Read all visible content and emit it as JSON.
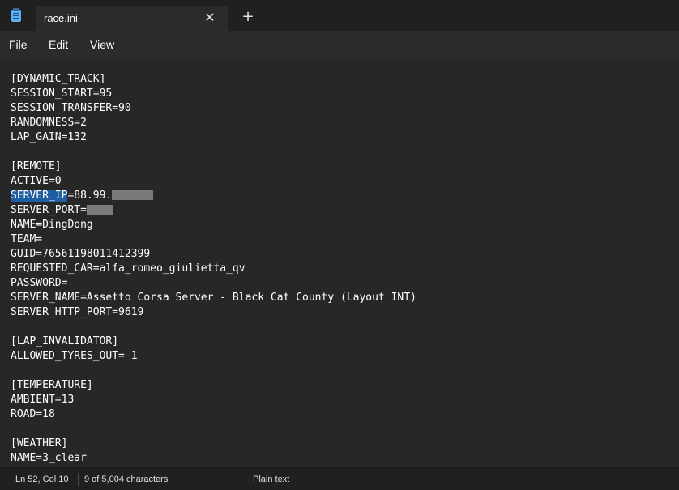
{
  "window": {
    "tab_title": "race.ini",
    "close_glyph": "✕",
    "new_tab_glyph": "+"
  },
  "menu": {
    "file": "File",
    "edit": "Edit",
    "view": "View"
  },
  "editor": {
    "lines": [
      "[DYNAMIC_TRACK]",
      "SESSION_START=95",
      "SESSION_TRANSFER=90",
      "RANDOMNESS=2",
      "LAP_GAIN=132",
      "",
      "[REMOTE]",
      "ACTIVE=0",
      "SERVER_IP=88.99.",
      "SERVER_PORT=",
      "NAME=DingDong",
      "TEAM=",
      "GUID=76561198011412399",
      "REQUESTED_CAR=alfa_romeo_giulietta_qv",
      "PASSWORD=",
      "SERVER_NAME=Assetto Corsa Server - Black Cat County (Layout INT)",
      "SERVER_HTTP_PORT=9619",
      "",
      "[LAP_INVALIDATOR]",
      "ALLOWED_TYRES_OUT=-1",
      "",
      "[TEMPERATURE]",
      "AMBIENT=13",
      "ROAD=18",
      "",
      "[WEATHER]",
      "NAME=3_clear"
    ],
    "selected_text": "SERVER_IP",
    "selected_rest": "=88.99."
  },
  "status": {
    "position": "Ln 52, Col 10",
    "selection": "9 of 5,004 characters",
    "format": "Plain text"
  },
  "colors": {
    "background": "#272727",
    "selection": "#1f5fa0",
    "redaction": "#7a7a7a"
  },
  "icons": {
    "app": "notepad-icon",
    "close": "close-icon",
    "new_tab": "plus-icon"
  }
}
